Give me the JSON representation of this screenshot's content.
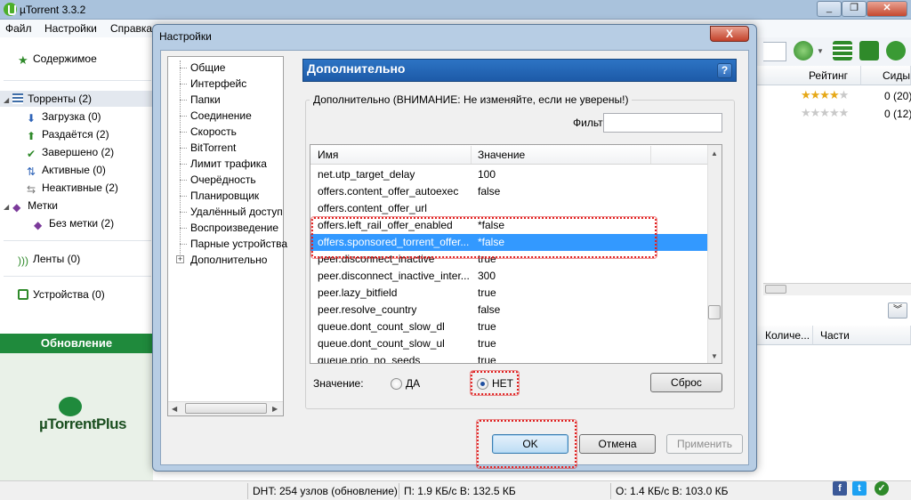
{
  "window": {
    "title": "µTorrent 3.3.2"
  },
  "menu": [
    "Файл",
    "Настройки",
    "Справка"
  ],
  "sidebar": {
    "content": "Содержимое",
    "torrents": "Торренты (2)",
    "items": [
      {
        "label": "Загрузка (0)",
        "icon": "download-arrow-icon"
      },
      {
        "label": "Раздаётся (2)",
        "icon": "upload-arrow-icon"
      },
      {
        "label": "Завершено (2)",
        "icon": "checkmark-icon"
      },
      {
        "label": "Активные (0)",
        "icon": "activity-icon"
      },
      {
        "label": "Неактивные (2)",
        "icon": "inactive-icon"
      }
    ],
    "labels": "Метки",
    "no_label": "Без метки (2)",
    "feeds": "Ленты (0)",
    "devices": "Устройства (0)",
    "update": "Обновление",
    "promo": "µTorrentPlus"
  },
  "torrent_list": {
    "columns": [
      "Рейтинг",
      "Сиды"
    ],
    "rows": [
      {
        "rating": 4,
        "seeds": "0 (20)"
      },
      {
        "rating": 0,
        "seeds": "0 (12)"
      }
    ]
  },
  "details": {
    "columns": [
      "Количе...",
      "Части"
    ]
  },
  "statusbar": {
    "dht": "DHT: 254 узлов  (обновление)",
    "download": "П: 1.9 КБ/с В: 132.5 КБ",
    "upload": "О: 1.4 КБ/с В: 103.0 КБ"
  },
  "dialog": {
    "title": "Настройки",
    "close": "X",
    "tree": [
      "Общие",
      "Интерфейс",
      "Папки",
      "Соединение",
      "Скорость",
      "BitTorrent",
      "Лимит трафика",
      "Очерёдность",
      "Планировщик",
      "Удалённый доступ",
      "Воспроизведение",
      "Парные устройства",
      "Дополнительно"
    ],
    "panel_title": "Дополнительно",
    "help": "?",
    "group_label": "Дополнительно (ВНИМАНИЕ: Не изменяйте, если не уверены!)",
    "filter_label": "Фильт",
    "filter_value": "",
    "list_headers": [
      "Имя",
      "Значение"
    ],
    "rows": [
      {
        "name": "net.utp_target_delay",
        "value": "100"
      },
      {
        "name": "offers.content_offer_autoexec",
        "value": "false"
      },
      {
        "name": "offers.content_offer_url",
        "value": ""
      },
      {
        "name": "offers.left_rail_offer_enabled",
        "value": "*false"
      },
      {
        "name": "offers.sponsored_torrent_offer...",
        "value": "*false"
      },
      {
        "name": "peer.disconnect_inactive",
        "value": "true"
      },
      {
        "name": "peer.disconnect_inactive_inter...",
        "value": "300"
      },
      {
        "name": "peer.lazy_bitfield",
        "value": "true"
      },
      {
        "name": "peer.resolve_country",
        "value": "false"
      },
      {
        "name": "queue.dont_count_slow_dl",
        "value": "true"
      },
      {
        "name": "queue.dont_count_slow_ul",
        "value": "true"
      },
      {
        "name": "queue.prio_no_seeds",
        "value": "true"
      }
    ],
    "selected_row": 4,
    "value_label": "Значение:",
    "radio_yes": "ДА",
    "radio_no": "НЕТ",
    "selected_radio": "НЕТ",
    "reset": "Сброс",
    "ok": "OK",
    "cancel": "Отмена",
    "apply": "Применить"
  },
  "colors": {
    "highlight": "#e02020",
    "selection": "#3399ff",
    "panel_header": "#2d74c4",
    "update_bar": "#1f8a3c"
  }
}
